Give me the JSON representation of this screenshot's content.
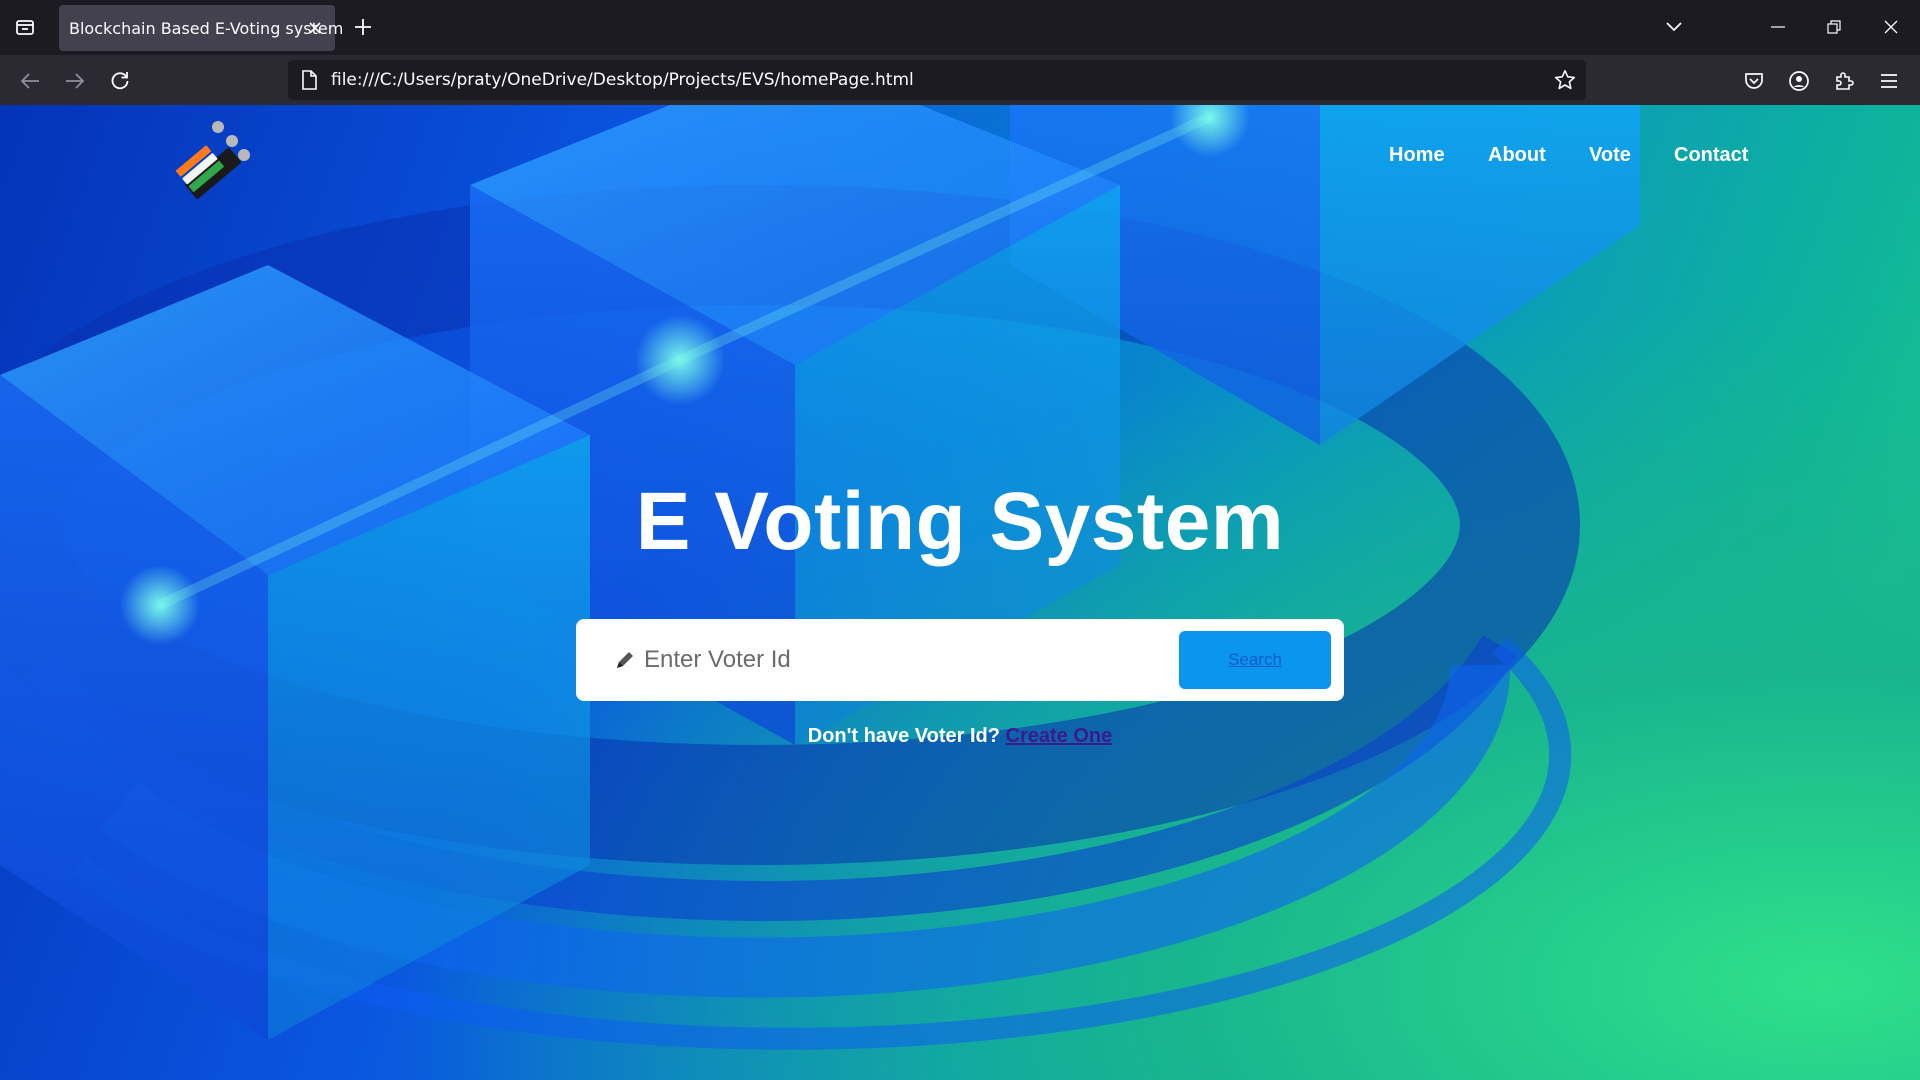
{
  "browser": {
    "tab_title": "Blockchain Based E-Voting system",
    "url": "file:///C:/Users/praty/OneDrive/Desktop/Projects/EVS/homePage.html"
  },
  "nav": {
    "items": [
      {
        "label": "Home"
      },
      {
        "label": "About"
      },
      {
        "label": "Vote"
      },
      {
        "label": "Contact"
      }
    ]
  },
  "hero": {
    "title": "E Voting System",
    "search_placeholder": "Enter Voter Id",
    "search_button": "Search",
    "signup_prompt": "Don't have Voter Id?",
    "signup_link": "Create One"
  },
  "colors": {
    "accent_button": "#0a96ee",
    "logo_orange": "#ff7a1a",
    "logo_green": "#2ea84a"
  },
  "icons": [
    "tab-overview-icon",
    "close-icon",
    "plus-icon",
    "chevron-down-icon",
    "minimize-icon",
    "restore-icon",
    "back-arrow-icon",
    "forward-arrow-icon",
    "reload-icon",
    "page-icon",
    "star-icon",
    "pocket-icon",
    "account-icon",
    "extensions-icon",
    "hamburger-menu-icon",
    "pencil-icon",
    "ballot-logo-icon"
  ]
}
